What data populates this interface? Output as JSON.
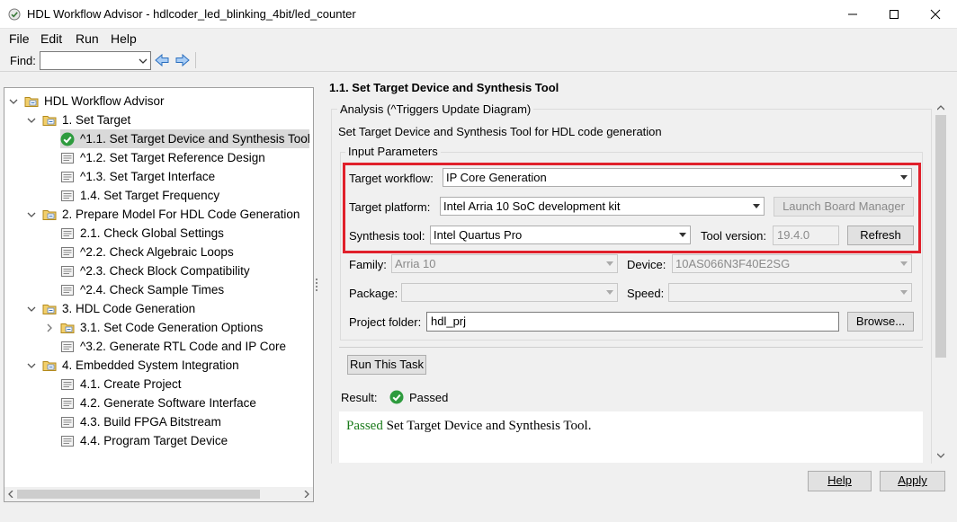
{
  "window": {
    "title": "HDL Workflow Advisor - hdlcoder_led_blinking_4bit/led_counter",
    "minimize_icon": "minimize-icon",
    "maximize_icon": "maximize-icon",
    "close_icon": "close-icon"
  },
  "menu": {
    "items": [
      "File",
      "Edit",
      "Run",
      "Help"
    ]
  },
  "findbar": {
    "label": "Find:",
    "value": "",
    "back_icon": "arrow-left-icon",
    "forward_icon": "arrow-right-icon"
  },
  "tree": {
    "items": [
      {
        "label": "HDL Workflow Advisor",
        "icon": "folder-icon",
        "expander": "open"
      },
      {
        "label": "1. Set Target",
        "icon": "folder-icon",
        "expander": "open"
      },
      {
        "label": "^1.1. Set Target Device and Synthesis Tool",
        "icon": "check-passed-icon",
        "expander": "",
        "selected": true
      },
      {
        "label": "^1.2. Set Target Reference Design",
        "icon": "task-page-icon",
        "expander": ""
      },
      {
        "label": "^1.3. Set Target Interface",
        "icon": "task-page-icon",
        "expander": ""
      },
      {
        "label": "1.4. Set Target Frequency",
        "icon": "task-page-icon",
        "expander": ""
      },
      {
        "label": "2. Prepare Model For HDL Code Generation",
        "icon": "folder-icon",
        "expander": "open"
      },
      {
        "label": "2.1. Check Global Settings",
        "icon": "task-page-icon",
        "expander": ""
      },
      {
        "label": "^2.2. Check Algebraic Loops",
        "icon": "task-page-icon",
        "expander": ""
      },
      {
        "label": "^2.3. Check Block Compatibility",
        "icon": "task-page-icon",
        "expander": ""
      },
      {
        "label": "^2.4. Check Sample Times",
        "icon": "task-page-icon",
        "expander": ""
      },
      {
        "label": "3. HDL Code Generation",
        "icon": "folder-icon",
        "expander": "open"
      },
      {
        "label": "3.1. Set Code Generation Options",
        "icon": "folder-icon",
        "expander": "closed"
      },
      {
        "label": "^3.2. Generate RTL Code and IP Core",
        "icon": "task-page-icon",
        "expander": ""
      },
      {
        "label": "4. Embedded System Integration",
        "icon": "folder-icon",
        "expander": "open"
      },
      {
        "label": "4.1. Create Project",
        "icon": "task-page-icon",
        "expander": ""
      },
      {
        "label": "4.2. Generate Software Interface",
        "icon": "task-page-icon",
        "expander": ""
      },
      {
        "label": "4.3. Build FPGA Bitstream",
        "icon": "task-page-icon",
        "expander": ""
      },
      {
        "label": "4.4. Program Target Device",
        "icon": "task-page-icon",
        "expander": ""
      }
    ]
  },
  "task": {
    "title": "1.1. Set Target Device and Synthesis Tool",
    "analysis_legend": "Analysis (^Triggers Update Diagram)",
    "description": "Set Target Device and Synthesis Tool for HDL code generation",
    "input_params_legend": "Input Parameters",
    "highlight_color": "#e0202b",
    "target_workflow_label": "Target workflow:",
    "target_workflow_value": "IP Core Generation",
    "target_platform_label": "Target platform:",
    "target_platform_value": "Intel Arria 10 SoC development kit",
    "launch_board_manager": "Launch Board Manager",
    "synthesis_tool_label": "Synthesis tool:",
    "synthesis_tool_value": "Intel Quartus Pro",
    "tool_version_label": "Tool version:",
    "tool_version_value": "19.4.0",
    "refresh": "Refresh",
    "family_label": "Family:",
    "family_value": "Arria 10",
    "device_label": "Device:",
    "device_value": "10AS066N3F40E2SG",
    "package_label": "Package:",
    "package_value": "",
    "speed_label": "Speed:",
    "speed_value": "",
    "project_folder_label": "Project folder:",
    "project_folder_value": "hdl_prj",
    "browse": "Browse...",
    "run_task": "Run This Task",
    "result_label": "Result:",
    "result_status": "Passed",
    "result_status_icon": "check-passed-icon",
    "result_msg_status": "Passed",
    "result_msg_text": " Set Target Device and Synthesis Tool.",
    "result_color": "#1a7a1a"
  },
  "footer": {
    "help": "Help",
    "apply": "Apply"
  }
}
